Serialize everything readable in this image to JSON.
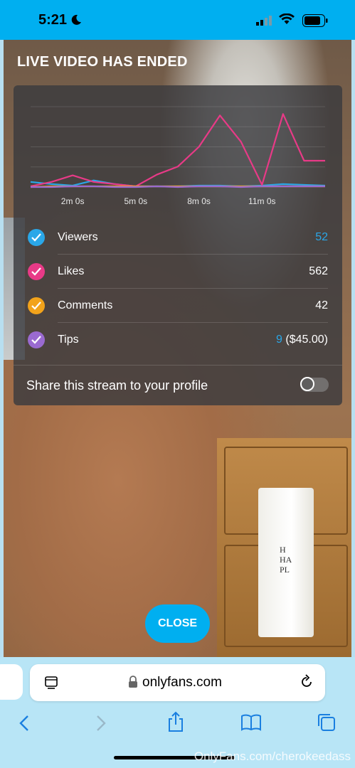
{
  "status": {
    "time": "5:21"
  },
  "title": "LIVE VIDEO HAS ENDED",
  "chart_data": {
    "type": "line",
    "x": [
      0,
      1,
      2,
      3,
      4,
      5,
      6,
      7,
      8,
      9,
      10,
      11,
      12,
      13,
      14
    ],
    "xticks": [
      "2m 0s",
      "5m 0s",
      "8m 0s",
      "11m 0s"
    ],
    "xtick_positions": [
      2,
      5,
      8,
      11
    ],
    "ylim": [
      0,
      110
    ],
    "grid": true,
    "series": [
      {
        "color": "#2aa7e8",
        "values": [
          7,
          4,
          2,
          9,
          4,
          1,
          1,
          1,
          2,
          2,
          1,
          2,
          4,
          3,
          2
        ]
      },
      {
        "color": "#e83a87",
        "values": [
          1,
          7,
          16,
          7,
          4,
          1,
          17,
          28,
          55,
          98,
          62,
          3,
          100,
          36,
          36
        ]
      },
      {
        "color": "#f2a31b",
        "values": [
          0,
          1,
          1,
          1,
          1,
          1,
          1,
          1,
          1,
          1,
          1,
          1,
          1,
          1,
          1
        ]
      },
      {
        "color": "#9a6ad0",
        "values": [
          0,
          0,
          1,
          1,
          0,
          0,
          1,
          0,
          1,
          1,
          0,
          1,
          1,
          1,
          1
        ]
      }
    ]
  },
  "metrics": [
    {
      "label": "Viewers",
      "value": "52",
      "color": "#2aa7e8"
    },
    {
      "label": "Likes",
      "value": "562",
      "color": "#e83a87"
    },
    {
      "label": "Comments",
      "value": "42",
      "color": "#f2a31b"
    },
    {
      "label": "Tips",
      "count": "9",
      "amount": "($45.00)",
      "color": "#9a6ad0"
    }
  ],
  "share": {
    "label": "Share this stream to your profile",
    "enabled": false
  },
  "close_label": "CLOSE",
  "browser": {
    "url": "onlyfans.com"
  },
  "towel_text": "H\nHA\nPL",
  "watermark": "OnlyFans.com/cherokeedass"
}
